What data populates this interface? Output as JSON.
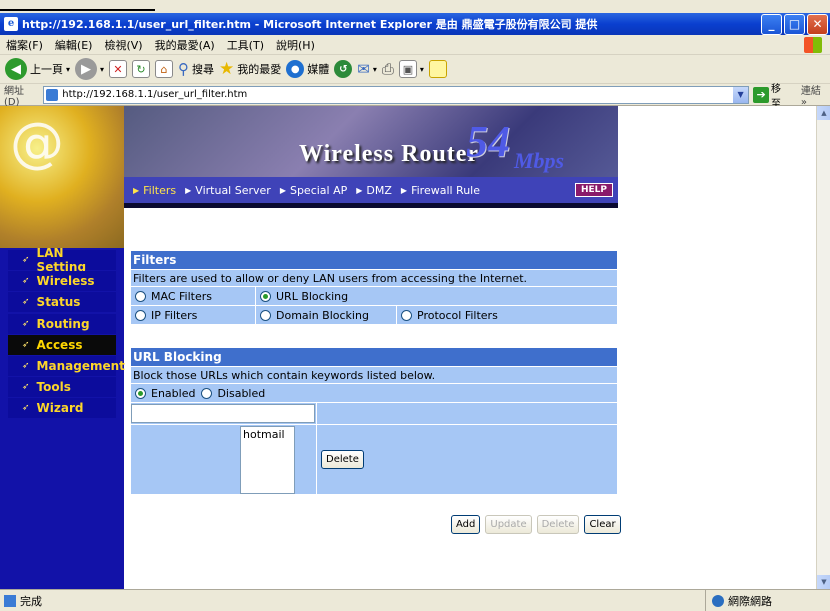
{
  "window": {
    "title": "http://192.168.1.1/user_url_filter.htm - Microsoft Internet Explorer 是由 鼎盛電子股份有限公司 提供",
    "minimize": "_",
    "maximize": "□",
    "close": "✕"
  },
  "menu": [
    "檔案(F)",
    "編輯(E)",
    "檢視(V)",
    "我的最愛(A)",
    "工具(T)",
    "說明(H)"
  ],
  "toolbar": {
    "back": "上一頁",
    "search": "搜尋",
    "favorites": "我的最愛",
    "media": "媒體"
  },
  "address": {
    "label": "網址(D)",
    "url": "http://192.168.1.1/user_url_filter.htm",
    "go": "移至",
    "links": "連結 »"
  },
  "sidebar": {
    "logo_glyph": "@",
    "items": [
      "LAN Setting",
      "Wireless",
      "Status",
      "Routing",
      "Access",
      "Management",
      "Tools",
      "Wizard"
    ],
    "active": "Access"
  },
  "banner": {
    "product": "Wireless Router",
    "speed": "54",
    "unit": "Mbps"
  },
  "tabs": [
    "Filters",
    "Virtual Server",
    "Special AP",
    "DMZ",
    "Firewall Rule"
  ],
  "help_label": "HELP",
  "filters": {
    "heading": "Filters",
    "description": "Filters are used to allow or deny LAN users from accessing the Internet.",
    "options": [
      "MAC Filters",
      "URL Blocking",
      "IP Filters",
      "Domain Blocking",
      "Protocol Filters"
    ],
    "selected": "URL Blocking"
  },
  "url_blocking": {
    "heading": "URL Blocking",
    "description": "Block those URLs which contain keywords listed below.",
    "enabled_label": "Enabled",
    "disabled_label": "Disabled",
    "state": "Enabled",
    "keyword_input": "",
    "keywords": [
      "hotmail"
    ],
    "delete_label": "Delete"
  },
  "actions": {
    "add": "Add",
    "update": "Update",
    "delete": "Delete",
    "clear": "Clear"
  },
  "status": {
    "text": "完成",
    "zone": "網際網路"
  }
}
